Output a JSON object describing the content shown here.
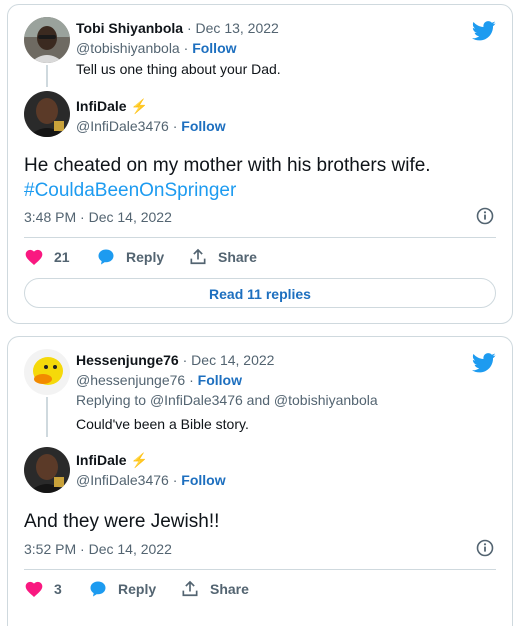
{
  "tweet1": {
    "parent": {
      "name": "Tobi Shiyanbola",
      "date": "Dec 13, 2022",
      "handle": "@tobishiyanbola",
      "follow": "Follow",
      "text": "Tell us one thing about your Dad."
    },
    "reply": {
      "name": "InfiDale",
      "emoji": "⚡",
      "handle": "@InfiDale3476",
      "follow": "Follow",
      "text_main": "He cheated on my mother with his brothers wife.",
      "hashtag": "#CouldaBeenOnSpringer",
      "timestamp": "3:48 PM · Dec 14, 2022",
      "likes": "21",
      "reply_label": "Reply",
      "share_label": "Share",
      "read_replies": "Read 11 replies"
    }
  },
  "tweet2": {
    "parent": {
      "name": "Hessenjunge76",
      "date": "Dec 14, 2022",
      "handle": "@hessenjunge76",
      "follow": "Follow",
      "replying_prefix": "Replying to",
      "replying_user1": "@InfiDale3476",
      "replying_and": "and",
      "replying_user2": "@tobishiyanbola",
      "text": "Could've been a Bible story."
    },
    "reply": {
      "name": "InfiDale",
      "emoji": "⚡",
      "handle": "@InfiDale3476",
      "follow": "Follow",
      "text_main": "And they were Jewish!!",
      "timestamp": "3:52 PM · Dec 14, 2022",
      "likes": "3",
      "reply_label": "Reply",
      "share_label": "Share"
    }
  },
  "colors": {
    "accent_blue": "#1d9bf0",
    "link_blue": "#1d6fbf",
    "like_pink": "#f91880",
    "muted": "#536471",
    "border": "#cfd9de"
  },
  "icons": [
    "twitter-bird-icon",
    "heart-icon",
    "reply-bubble-icon",
    "share-icon",
    "info-icon"
  ]
}
